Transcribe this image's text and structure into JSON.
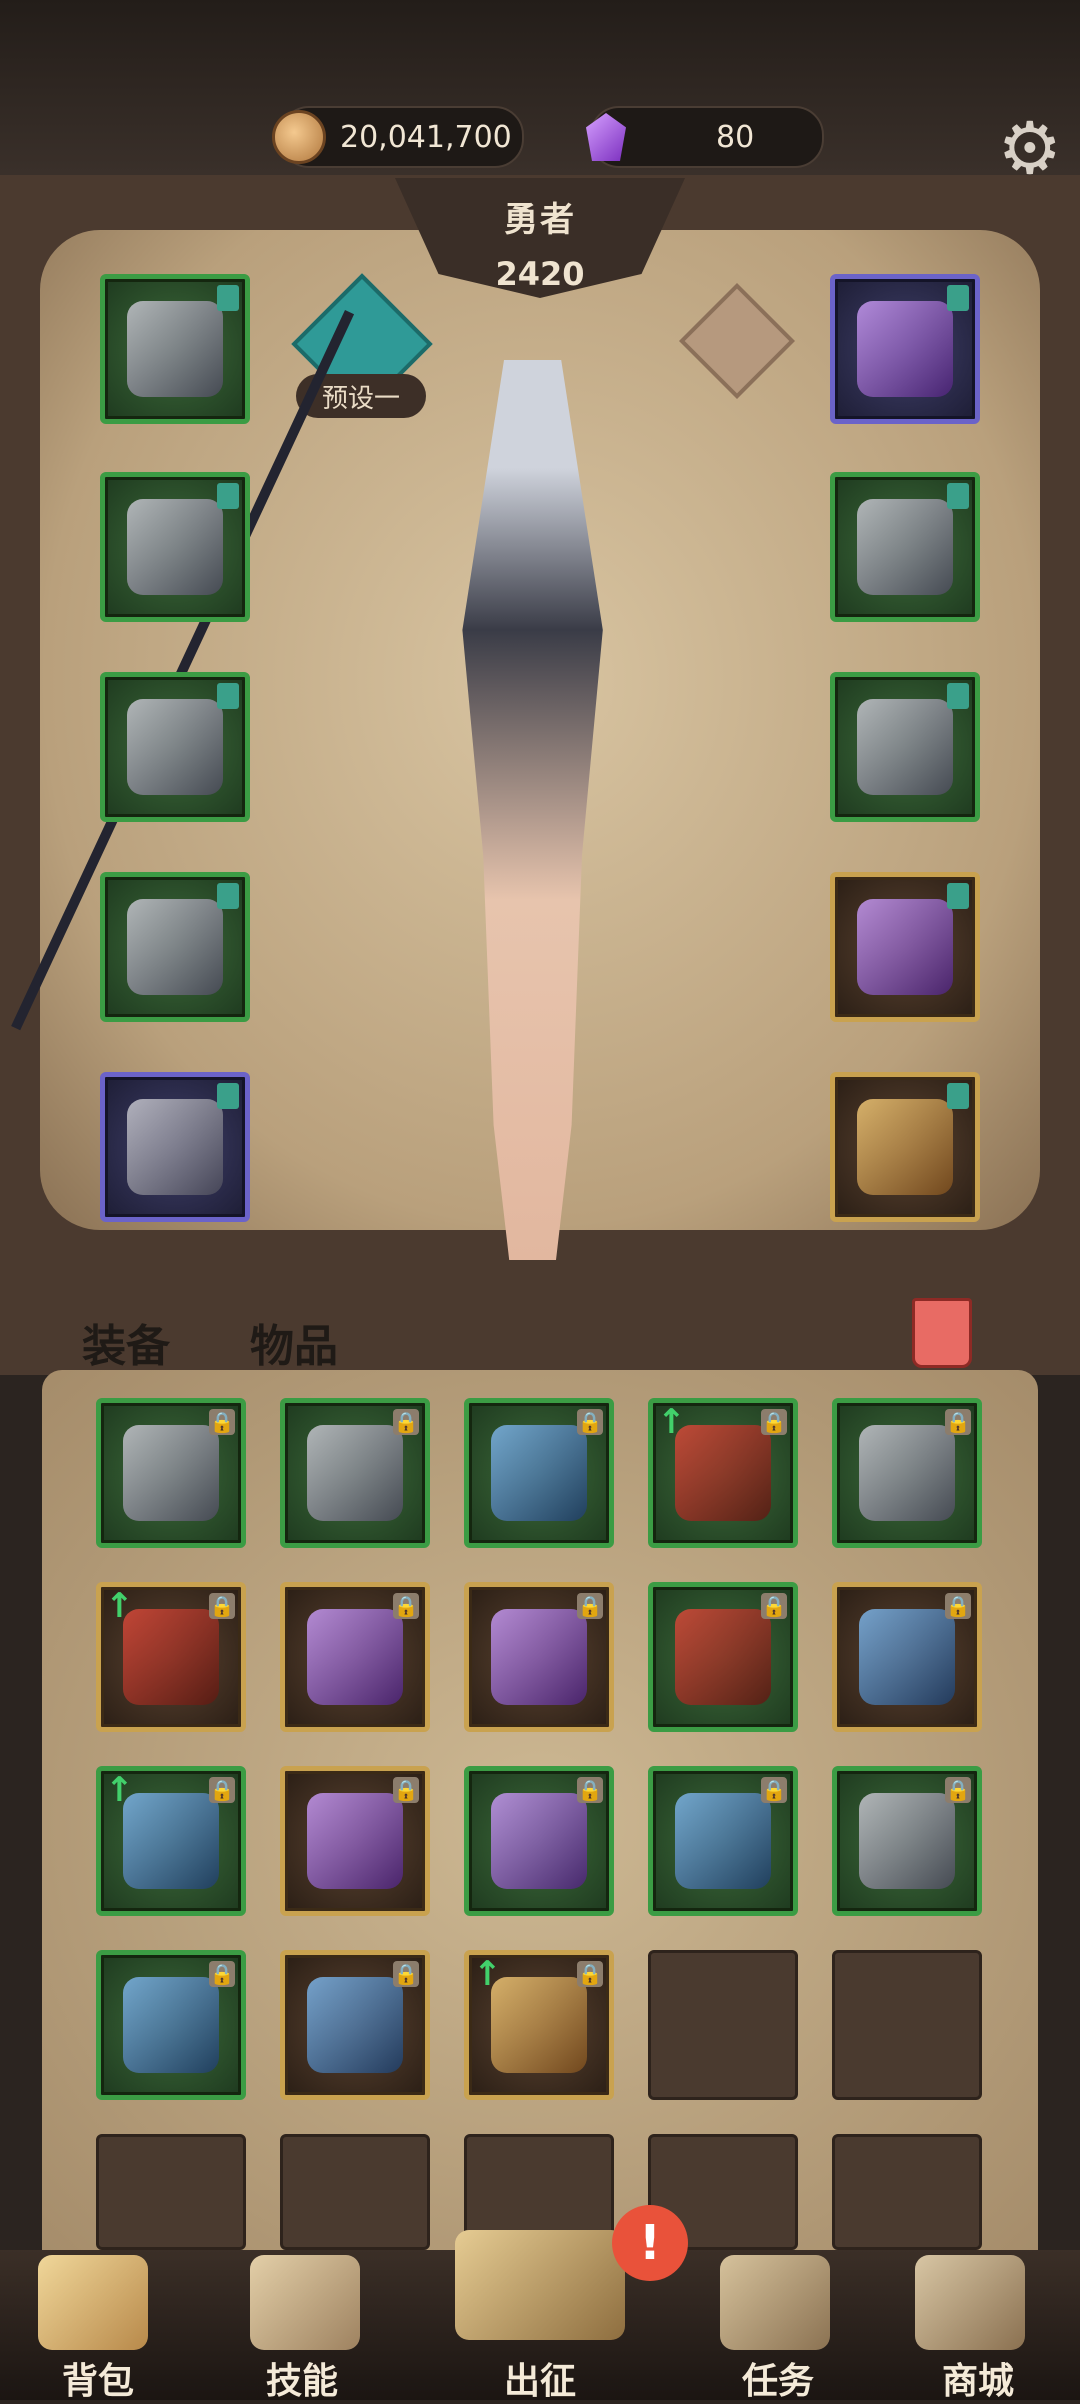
{
  "currency": {
    "gold": "20,041,700",
    "gems": "80"
  },
  "hero": {
    "title": "勇者",
    "power": "2420",
    "preset": "预设一"
  },
  "inventory_tabs": {
    "equipment": "装备",
    "items": "物品"
  },
  "nav": {
    "bag": "背包",
    "skills": "技能",
    "expedition": "出征",
    "tasks": "任务",
    "shop": "商城"
  },
  "alert_badge": "!",
  "icons": [
    "coin-icon",
    "gem-icon",
    "gear-icon",
    "trash-icon",
    "lock-icon",
    "upgrade-arrow-icon"
  ],
  "colors": {
    "rarity_green": "#3b9c44",
    "rarity_purple": "#6b63c9",
    "rarity_gold": "#c9a24f",
    "accent_teal": "#2f9a97"
  }
}
